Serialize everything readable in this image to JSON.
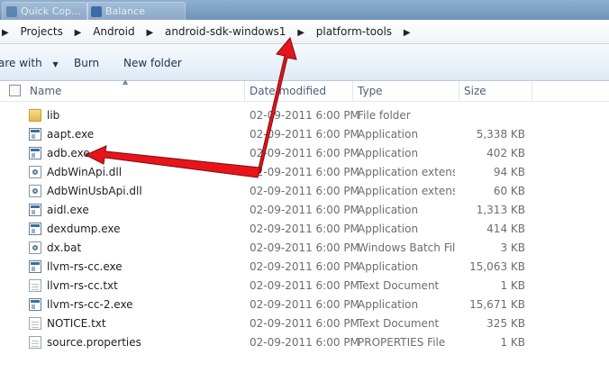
{
  "taskbar": {
    "tabs": [
      {
        "label": "Quick Cop...",
        "icon": "app-icon"
      },
      {
        "label": "Balance",
        "icon": "app-icon"
      }
    ]
  },
  "address_bar": {
    "crumbs": [
      "Projects",
      "Android",
      "android-sdk-windows1",
      "platform-tools"
    ],
    "separator_icon": "chevron-right-icon"
  },
  "toolbar": {
    "share_label": "are with",
    "burn_label": "Burn",
    "new_folder_label": "New folder"
  },
  "columns": {
    "name": "Name",
    "date": "Date modified",
    "type": "Type",
    "size": "Size"
  },
  "files": [
    {
      "name": "lib",
      "date": "02-09-2011 6:00 PM",
      "type": "File folder",
      "size": "",
      "icon": "folder-icon"
    },
    {
      "name": "aapt.exe",
      "date": "02-09-2011 6:00 PM",
      "type": "Application",
      "size": "5,338 KB",
      "icon": "application-icon"
    },
    {
      "name": "adb.exe",
      "date": "02-09-2011 6:00 PM",
      "type": "Application",
      "size": "402 KB",
      "icon": "application-icon"
    },
    {
      "name": "AdbWinApi.dll",
      "date": "02-09-2011 6:00 PM",
      "type": "Application extens...",
      "size": "94 KB",
      "icon": "dll-icon"
    },
    {
      "name": "AdbWinUsbApi.dll",
      "date": "02-09-2011 6:00 PM",
      "type": "Application extens...",
      "size": "60 KB",
      "icon": "dll-icon"
    },
    {
      "name": "aidl.exe",
      "date": "02-09-2011 6:00 PM",
      "type": "Application",
      "size": "1,313 KB",
      "icon": "application-icon"
    },
    {
      "name": "dexdump.exe",
      "date": "02-09-2011 6:00 PM",
      "type": "Application",
      "size": "414 KB",
      "icon": "application-icon"
    },
    {
      "name": "dx.bat",
      "date": "02-09-2011 6:00 PM",
      "type": "Windows Batch File",
      "size": "3 KB",
      "icon": "batch-file-icon"
    },
    {
      "name": "llvm-rs-cc.exe",
      "date": "02-09-2011 6:00 PM",
      "type": "Application",
      "size": "15,063 KB",
      "icon": "application-icon"
    },
    {
      "name": "llvm-rs-cc.txt",
      "date": "02-09-2011 6:00 PM",
      "type": "Text Document",
      "size": "1 KB",
      "icon": "text-document-icon"
    },
    {
      "name": "llvm-rs-cc-2.exe",
      "date": "02-09-2011 6:00 PM",
      "type": "Application",
      "size": "15,671 KB",
      "icon": "application-icon"
    },
    {
      "name": "NOTICE.txt",
      "date": "02-09-2011 6:00 PM",
      "type": "Text Document",
      "size": "325 KB",
      "icon": "text-document-icon"
    },
    {
      "name": "source.properties",
      "date": "02-09-2011 6:00 PM",
      "type": "PROPERTIES File",
      "size": "1 KB",
      "icon": "text-document-icon"
    }
  ],
  "annotations": {
    "arrow_color": "#e8141b"
  },
  "colors": {
    "toolbar_text": "#1e3050",
    "header_text": "#4c607a",
    "secondary_text": "#6d6d6d"
  }
}
